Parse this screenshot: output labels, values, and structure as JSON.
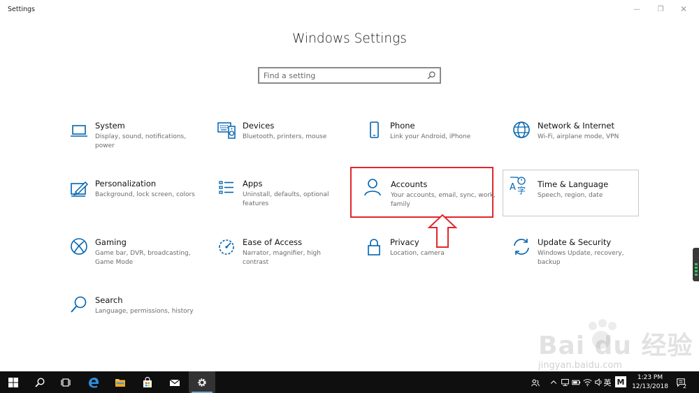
{
  "window": {
    "title": "Settings",
    "minimize_glyph": "—",
    "maximize_glyph": "❐",
    "close_glyph": "✕"
  },
  "page": {
    "title": "Windows Settings"
  },
  "search": {
    "placeholder": "Find a setting"
  },
  "tiles": [
    {
      "name": "System",
      "desc": "Display, sound, notifications, power",
      "icon": "laptop-icon"
    },
    {
      "name": "Devices",
      "desc": "Bluetooth, printers, mouse",
      "icon": "keyboard-speaker-icon"
    },
    {
      "name": "Phone",
      "desc": "Link your Android, iPhone",
      "icon": "phone-icon"
    },
    {
      "name": "Network & Internet",
      "desc": "Wi-Fi, airplane mode, VPN",
      "icon": "globe-icon"
    },
    {
      "name": "Personalization",
      "desc": "Background, lock screen, colors",
      "icon": "paint-icon"
    },
    {
      "name": "Apps",
      "desc": "Uninstall, defaults, optional features",
      "icon": "apps-list-icon"
    },
    {
      "name": "Accounts",
      "desc": "Your accounts, email, sync, work, family",
      "icon": "person-icon"
    },
    {
      "name": "Time & Language",
      "desc": "Speech, region, date",
      "icon": "time-language-icon"
    },
    {
      "name": "Gaming",
      "desc": "Game bar, DVR, broadcasting, Game Mode",
      "icon": "xbox-icon"
    },
    {
      "name": "Ease of Access",
      "desc": "Narrator, magnifier, high contrast",
      "icon": "ease-of-access-icon"
    },
    {
      "name": "Privacy",
      "desc": "Location, camera",
      "icon": "lock-icon"
    },
    {
      "name": "Update & Security",
      "desc": "Windows Update, recovery, backup",
      "icon": "sync-icon"
    },
    {
      "name": "Search",
      "desc": "Language, permissions, history",
      "icon": "magnifier-icon"
    }
  ],
  "colors": {
    "accent": "#0063b1",
    "highlight": "#e2262c",
    "taskbar": "#0f0f0f"
  },
  "watermark": {
    "text": "Bai du 经验",
    "url": "jingyan.baidu.com"
  },
  "taskbar": {
    "input_indicator": "英",
    "tray_app_label": "M",
    "clock_time": "1:23 PM",
    "clock_date": "12/13/2018",
    "notification_count": "2"
  }
}
